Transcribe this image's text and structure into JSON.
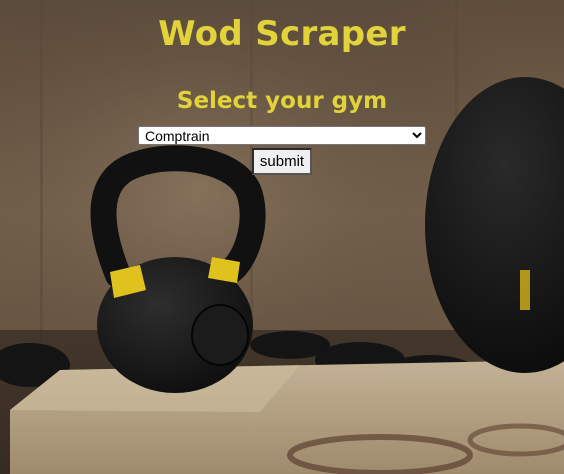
{
  "page": {
    "title": "Wod Scraper",
    "subtitle": "Select your gym"
  },
  "form": {
    "gym_select": {
      "selected": "Comptrain",
      "options": [
        "Comptrain"
      ]
    },
    "submit_label": "submit"
  },
  "background": {
    "description_icon": "kettlebell-medicine-ball-photo",
    "colors": {
      "wall": "#6b5a47",
      "kettlebell": "#1a1a1a",
      "kettlebell_band": "#e0c21e",
      "box": "#b8a68a"
    }
  },
  "colors": {
    "heading": "#e3d33a"
  }
}
